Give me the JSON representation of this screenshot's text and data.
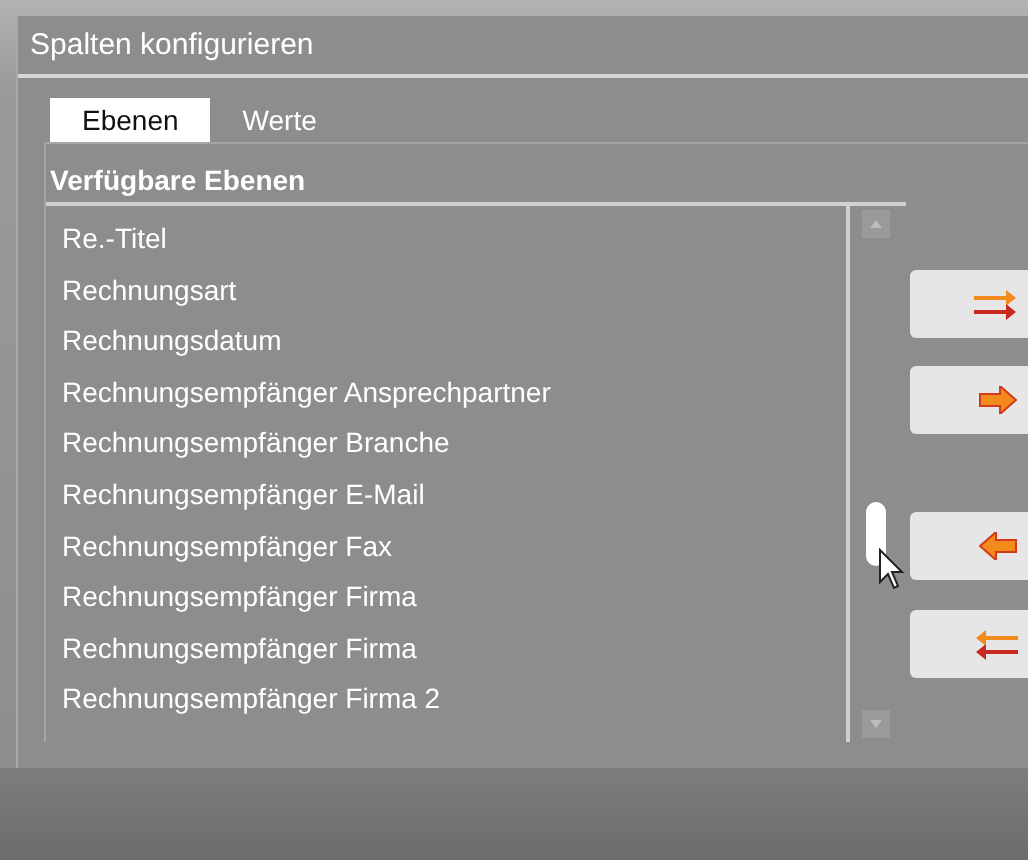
{
  "dialog": {
    "title": "Spalten konfigurieren"
  },
  "tabs": [
    {
      "label": "Ebenen",
      "selected": true
    },
    {
      "label": "Werte",
      "selected": false
    }
  ],
  "available_levels": {
    "heading": "Verfügbare Ebenen",
    "items": [
      "Re.-Titel",
      "Rechnungsart",
      "Rechnungsdatum",
      "Rechnungsempfänger Ansprechpartner",
      "Rechnungsempfänger Branche",
      "Rechnungsempfänger E-Mail",
      "Rechnungsempfänger Fax",
      "Rechnungsempfänger Firma",
      "Rechnungsempfänger Firma",
      "Rechnungsempfänger Firma 2"
    ]
  },
  "move_buttons": [
    {
      "kind": "add-all"
    },
    {
      "kind": "add"
    },
    {
      "kind": "remove"
    },
    {
      "kind": "remove-all"
    }
  ]
}
